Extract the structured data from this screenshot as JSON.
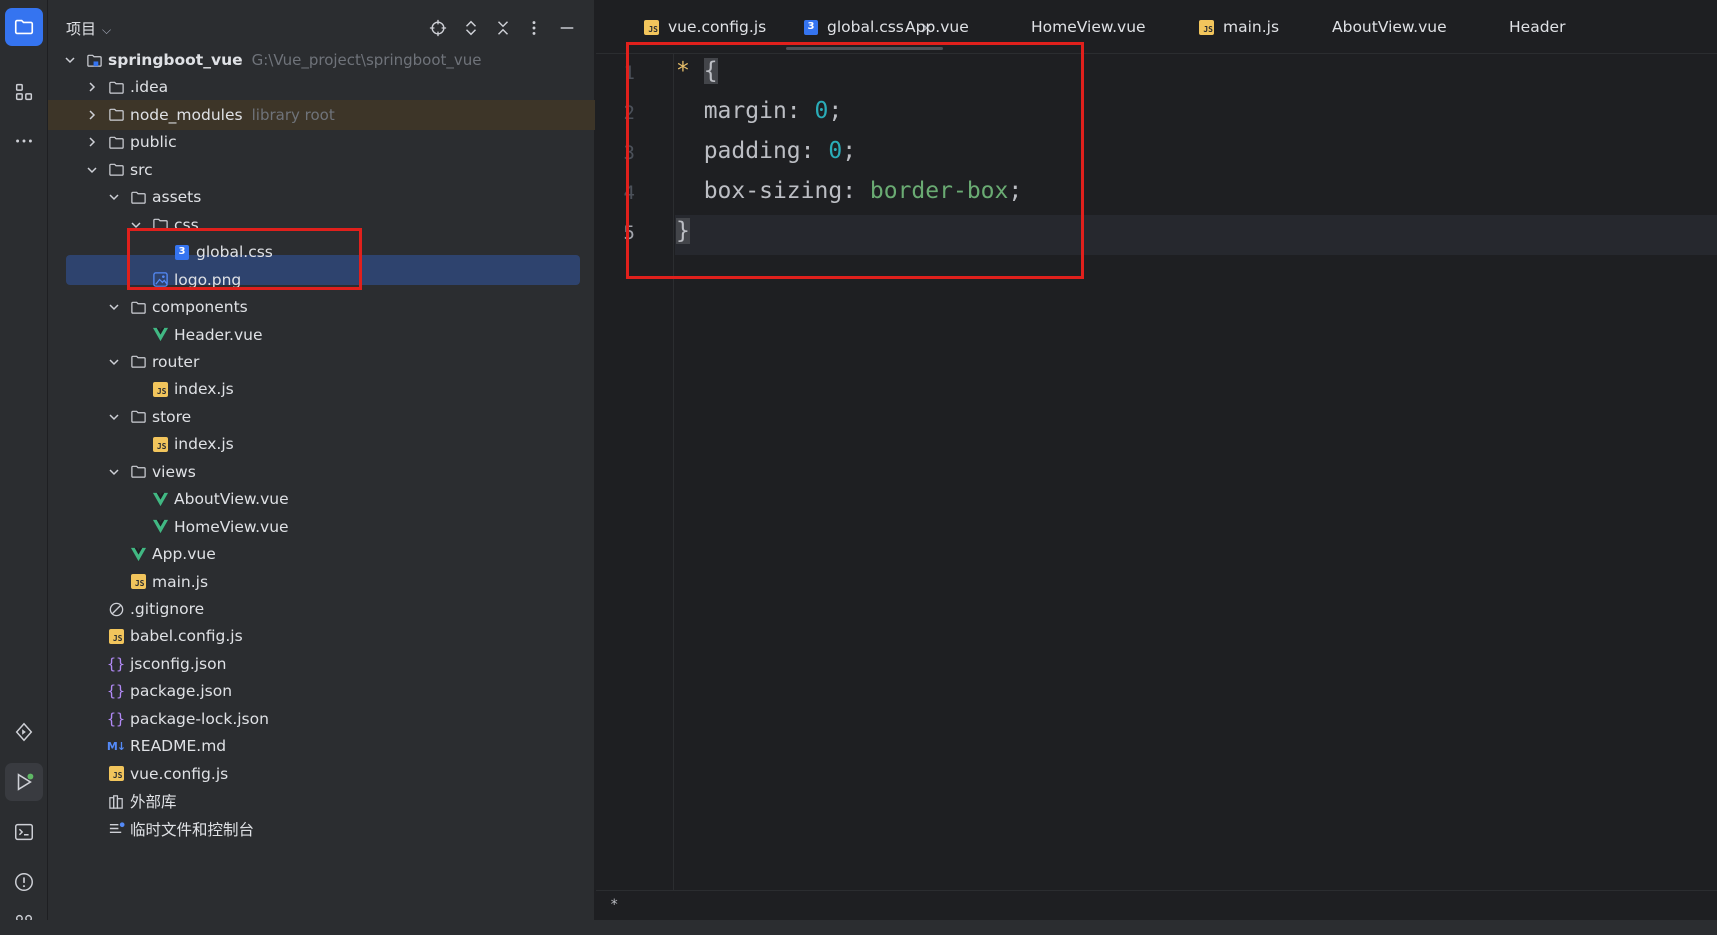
{
  "activity": {
    "top": [
      "folder-icon",
      "structure-icon",
      "more-icon"
    ],
    "bottom": [
      "services-icon",
      "run-icon",
      "terminal-icon",
      "problems-icon",
      "git-icon"
    ]
  },
  "project": {
    "title": "项目",
    "header_icons": [
      "locate-icon",
      "expand-all-icon",
      "collapse-all-icon",
      "options-icon",
      "minimize-icon"
    ],
    "root_name": "springboot_vue",
    "root_path": "G:\\Vue_project\\springboot_vue",
    "items": [
      {
        "label": "springboot_vue",
        "hint": "G:\\Vue_project\\springboot_vue",
        "depth": 0,
        "arrow": "down",
        "icon": "module-folder"
      },
      {
        "label": ".idea",
        "depth": 1,
        "arrow": "right",
        "icon": "folder"
      },
      {
        "label": "node_modules",
        "hint": "library root",
        "depth": 1,
        "arrow": "right",
        "icon": "folder"
      },
      {
        "label": "public",
        "depth": 1,
        "arrow": "right",
        "icon": "folder"
      },
      {
        "label": "src",
        "depth": 1,
        "arrow": "down",
        "icon": "folder"
      },
      {
        "label": "assets",
        "depth": 2,
        "arrow": "down",
        "icon": "folder"
      },
      {
        "label": "css",
        "depth": 3,
        "arrow": "down",
        "icon": "folder"
      },
      {
        "label": "global.css",
        "depth": 4,
        "icon": "css"
      },
      {
        "label": "logo.png",
        "depth": 3,
        "icon": "image"
      },
      {
        "label": "components",
        "depth": 2,
        "arrow": "down",
        "icon": "folder"
      },
      {
        "label": "Header.vue",
        "depth": 3,
        "icon": "vue"
      },
      {
        "label": "router",
        "depth": 2,
        "arrow": "down",
        "icon": "folder"
      },
      {
        "label": "index.js",
        "depth": 3,
        "icon": "js"
      },
      {
        "label": "store",
        "depth": 2,
        "arrow": "down",
        "icon": "folder"
      },
      {
        "label": "index.js",
        "depth": 3,
        "icon": "js"
      },
      {
        "label": "views",
        "depth": 2,
        "arrow": "down",
        "icon": "folder"
      },
      {
        "label": "AboutView.vue",
        "depth": 3,
        "icon": "vue"
      },
      {
        "label": "HomeView.vue",
        "depth": 3,
        "icon": "vue"
      },
      {
        "label": "App.vue",
        "depth": 2,
        "icon": "vue"
      },
      {
        "label": "main.js",
        "depth": 2,
        "icon": "js"
      },
      {
        "label": ".gitignore",
        "depth": 1,
        "icon": "ignore"
      },
      {
        "label": "babel.config.js",
        "depth": 1,
        "icon": "js"
      },
      {
        "label": "jsconfig.json",
        "depth": 1,
        "icon": "json"
      },
      {
        "label": "package.json",
        "depth": 1,
        "icon": "json"
      },
      {
        "label": "package-lock.json",
        "depth": 1,
        "icon": "json"
      },
      {
        "label": "README.md",
        "depth": 1,
        "icon": "md"
      },
      {
        "label": "vue.config.js",
        "depth": 1,
        "icon": "js"
      },
      {
        "label": "外部库",
        "depth": 0,
        "icon": "library"
      },
      {
        "label": "临时文件和控制台",
        "depth": 0,
        "icon": "scratch"
      }
    ]
  },
  "tabs": [
    {
      "label": "vue.config.js",
      "icon": "js"
    },
    {
      "label": "global.css",
      "icon": "css",
      "active": true,
      "close": "×"
    },
    {
      "label": "App.vue",
      "icon": "vue"
    },
    {
      "label": "HomeView.vue",
      "icon": "vue"
    },
    {
      "label": "main.js",
      "icon": "js"
    },
    {
      "label": "AboutView.vue",
      "icon": "vue"
    },
    {
      "label": "Header",
      "icon": "vue"
    }
  ],
  "editor": {
    "line_numbers": [
      "1",
      "2",
      "3",
      "4",
      "5"
    ],
    "code": {
      "l1_sel": "*",
      "l1_brace": "{",
      "l2_prop": "margin",
      "l2_colon": ": ",
      "l2_val": "0",
      "l2_semi": ";",
      "l3_prop": "padding",
      "l3_colon": ": ",
      "l3_val": "0",
      "l3_semi": ";",
      "l4_prop": "box-sizing",
      "l4_colon": ": ",
      "l4_val": "border-box",
      "l4_semi": ";",
      "l5_brace": "}"
    },
    "breadcrumb": "*"
  },
  "colors": {
    "highlight_box": "#e0201c",
    "selection": "#2e436e",
    "accent": "#3574f0"
  }
}
